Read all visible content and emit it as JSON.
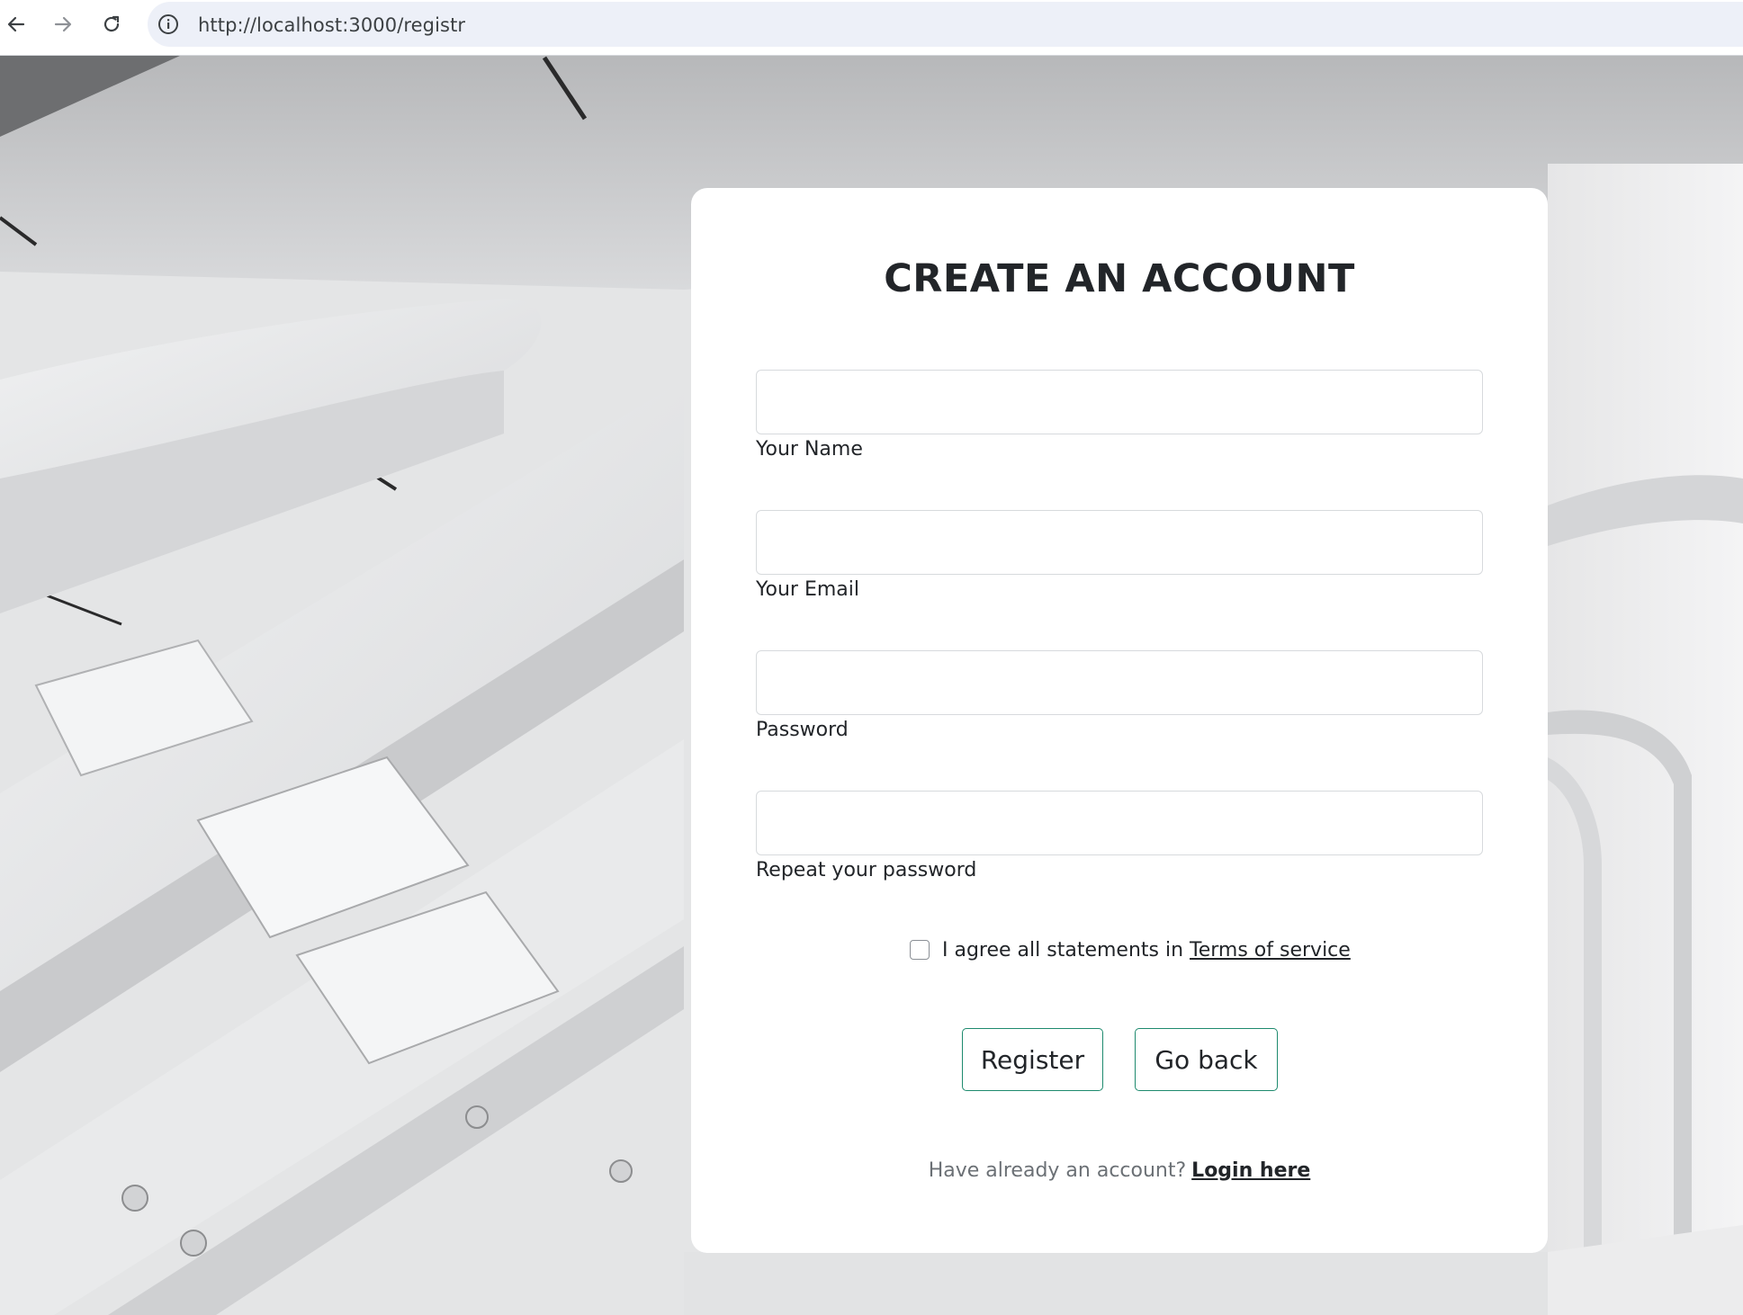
{
  "browser": {
    "url": "http://localhost:3000/registr",
    "back_icon": "arrow-left-icon",
    "forward_icon": "arrow-right-icon",
    "reload_icon": "reload-icon",
    "info_icon": "info-icon"
  },
  "form": {
    "title": "CREATE AN ACCOUNT",
    "fields": [
      {
        "label": "Your Name",
        "value": ""
      },
      {
        "label": "Your Email",
        "value": ""
      },
      {
        "label": "Password",
        "value": ""
      },
      {
        "label": "Repeat your password",
        "value": ""
      }
    ],
    "terms": {
      "checked": false,
      "text": "I agree all statements in",
      "link": "Terms of service"
    },
    "buttons": {
      "register": "Register",
      "go_back": "Go back"
    },
    "footer": {
      "text": "Have already an account?",
      "link": "Login here"
    }
  },
  "colors": {
    "button_border": "#1e8a6e",
    "card": "#ffffff",
    "title": "#222529"
  }
}
